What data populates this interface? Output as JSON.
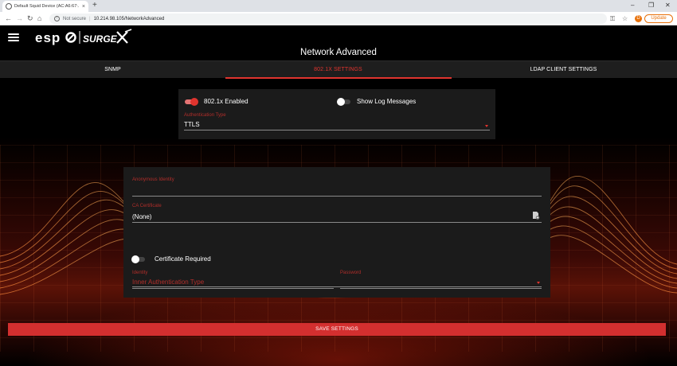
{
  "browser": {
    "tab_title": "Default Squid Device (AC:A6:67:…",
    "tab_close": "×",
    "new_tab": "+",
    "security_label": "Not secure",
    "url": "10.214.98.105/NetworkAdvanced",
    "profile_initial": "D",
    "update_label": "Update",
    "nav_back": "←",
    "nav_forward": "→",
    "nav_reload": "↻",
    "nav_home": "⌂",
    "key_icon": "⚿",
    "star_icon": "☆",
    "menu_dots": "⋮",
    "win_min": "–",
    "win_restore": "❐",
    "win_close": "✕"
  },
  "app": {
    "page_title": "Network Advanced",
    "tabs": [
      {
        "label": "SNMP"
      },
      {
        "label": "802.1X SETTINGS"
      },
      {
        "label": "LDAP CLIENT SETTINGS"
      }
    ],
    "active_tab": 1,
    "card1": {
      "enabled_label": "802.1x Enabled",
      "enabled_on": true,
      "log_label": "Show Log Messages",
      "log_on": false,
      "auth_type_label": "Authentication Type",
      "auth_type_value": "TTLS"
    },
    "card2": {
      "anon_identity_label": "Anonymous Identity",
      "anon_identity_value": "",
      "ca_cert_label": "CA Certificate",
      "ca_cert_value": "(None)",
      "cert_required_label": "Certificate Required",
      "cert_required_on": false,
      "inner_auth_placeholder": "Inner Authentication Type",
      "identity_label": "Identity",
      "identity_value": "",
      "password_label": "Password",
      "password_value": ""
    },
    "save_label": "SAVE SETTINGS",
    "colors": {
      "accent": "#e0342e",
      "label_red": "#b12e2a",
      "card_bg": "#1b1b1b",
      "tabbar_bg": "#1e1e1e",
      "save_bg": "#d32f2f"
    }
  }
}
